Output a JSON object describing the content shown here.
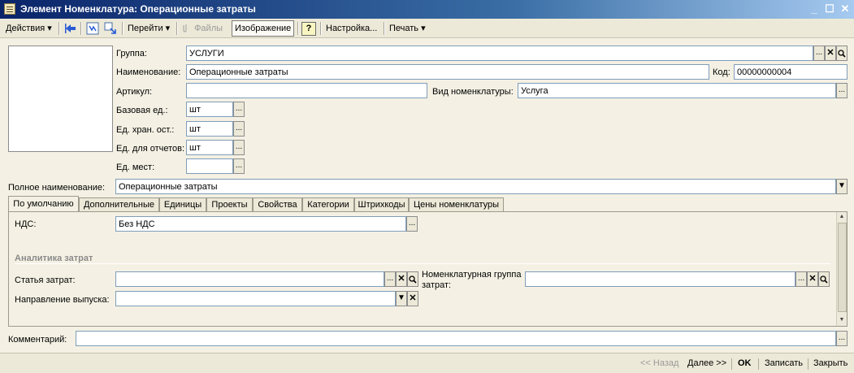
{
  "window": {
    "title": "Элемент Номенклатура: Операционные затраты",
    "controls": {
      "minimize": "_",
      "maximize": "☐",
      "close": "✕"
    }
  },
  "toolbar": {
    "actions": "Действия",
    "go": "Перейти",
    "files": "Файлы",
    "image": "Изображение",
    "help": "?",
    "settings": "Настройка...",
    "print": "Печать",
    "dropdown_arrow": "▾"
  },
  "form": {
    "group": {
      "label": "Группа:",
      "value": "УСЛУГИ"
    },
    "name": {
      "label": "Наименование:",
      "value": "Операционные затраты"
    },
    "code": {
      "label": "Код:",
      "value": "00000000004"
    },
    "article": {
      "label": "Артикул:",
      "value": ""
    },
    "kind": {
      "label": "Вид номенклатуры:",
      "value": "Услуга"
    },
    "base_unit": {
      "label": "Базовая ед.:",
      "value": "шт"
    },
    "storage_unit": {
      "label": "Ед. хран. ост.:",
      "value": "шт"
    },
    "report_unit": {
      "label": "Ед. для отчетов:",
      "value": "шт"
    },
    "place_unit": {
      "label": "Ед. мест:",
      "value": ""
    },
    "full_name": {
      "label": "Полное наименование:",
      "value": "Операционные затраты"
    },
    "comment": {
      "label": "Комментарий:",
      "value": ""
    }
  },
  "tabs": [
    "По умолчанию",
    "Дополнительные",
    "Единицы",
    "Проекты",
    "Свойства",
    "Категории",
    "Штрихкоды",
    "Цены номенклатуры"
  ],
  "tab_default": {
    "vat": {
      "label": "НДС:",
      "value": "Без НДС"
    },
    "section_title": "Аналитика затрат",
    "cost_item": {
      "label": "Статья затрат:",
      "value": ""
    },
    "output_direction": {
      "label": "Направление выпуска:",
      "value": ""
    },
    "nomen_group": {
      "label_line1": "Номенклатурная группа",
      "label_line2": "затрат:",
      "value": ""
    }
  },
  "buttons": {
    "select": "...",
    "clear": "✕",
    "open": "🔍",
    "dropdown": "▼"
  },
  "footer": {
    "back": "<< Назад",
    "next": "Далее >>",
    "ok": "OK",
    "save": "Записать",
    "close": "Закрыть"
  },
  "colors": {
    "title_gradient_start": "#0a246a",
    "form_background": "#f4f1e4",
    "field_border": "#7f9db9"
  }
}
